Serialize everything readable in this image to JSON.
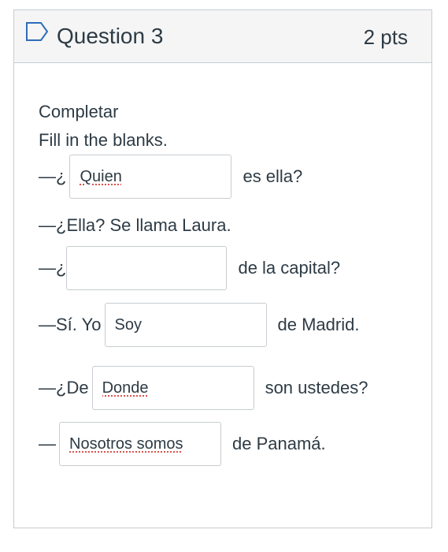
{
  "question": {
    "title": "Question 3",
    "points": "2 pts",
    "flag_icon": "flag-outline-icon"
  },
  "instructions": {
    "heading": "Completar",
    "subheading": "Fill in the blanks."
  },
  "lines": [
    {
      "before": "—¿",
      "value": "Quien",
      "after": "es ella?"
    },
    {
      "text": "—¿Ella? Se llama Laura."
    },
    {
      "before": "—¿",
      "value": "",
      "after": "de la capital?"
    },
    {
      "before": "—Sí. Yo",
      "value": "Soy",
      "after": "de Madrid."
    },
    {
      "before": "—¿De",
      "value": "Donde",
      "after": "son ustedes?"
    },
    {
      "before": "—",
      "value": "Nosotros somos",
      "after": "de Panamá."
    }
  ],
  "colors": {
    "header_bg": "#f5f5f5",
    "border": "#c7cdd1",
    "text": "#2d3b45",
    "spellcheck": "#d9534f"
  }
}
